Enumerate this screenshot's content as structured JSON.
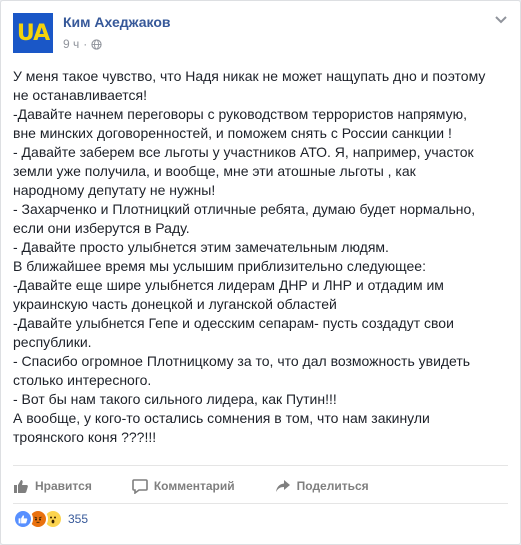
{
  "colors": {
    "link_blue": "#365899",
    "meta_gray": "#90949c",
    "avatar_bg": "#1a57c7",
    "avatar_text": "#f3d20c",
    "like_blue": "#5890ff",
    "angry_orange": "#e9710f",
    "wow_yellow": "#fcd44f"
  },
  "post": {
    "avatar_text": "UA",
    "author": "Ким Ахеджаков",
    "time": "9 ч",
    "separator": "·",
    "privacy_icon": "globe-icon",
    "menu_icon": "chevron-down-icon",
    "lines": [
      "У меня такое чувство, что Надя никак не может нащупать дно и поэтому",
      "не останавливается!",
      "-Давайте начнем переговоры с руководством террористов напрямую,",
      "вне минских договоренностей, и поможем снять с России санкции !",
      "- Давайте заберем все льготы у участников АТО. Я, например, участок",
      "земли уже получила, и вообще, мне эти атошные льготы , как",
      "народному депутату не нужны!",
      "- Захарченко и Плотницкий отличные ребята, думаю будет нормально,",
      "если они изберутся в Раду.",
      "- Давайте просто улыбнется этим замечательным людям.",
      "В ближайшее время мы услышим приблизительно следующее:",
      "-Давайте еще шире улыбнется лидерам ДНР и ЛНР и отдадим им",
      "украинскую часть донецкой и луганской областей",
      "-Давайте улыбнется Гепе и одесским сепарам- пусть создадут свои",
      "республики.",
      "- Спасибо огромное Плотницкому за то, что дал возможность увидеть",
      "столько интересного.",
      "- Вот бы нам такого сильного лидера, как Путин!!!",
      "А вообще, у кого-то остались сомнения в том, что нам закинули",
      "троянского коня ???!!!"
    ]
  },
  "actions": {
    "like_label": "Нравится",
    "comment_label": "Комментарий",
    "share_label": "Поделиться"
  },
  "reactions": {
    "icons": [
      "like-reaction-icon",
      "angry-reaction-icon",
      "wow-reaction-icon"
    ],
    "count": "355"
  }
}
